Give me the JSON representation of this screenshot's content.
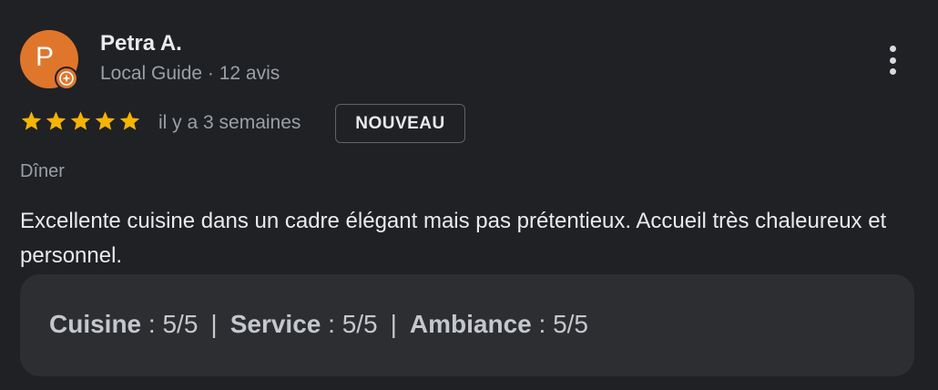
{
  "reviewer": {
    "initial": "P",
    "name": "Petra A.",
    "meta": "Local Guide · 12 avis",
    "avatar_color": "#e0762b",
    "badge_icon": "local-guide-star-icon"
  },
  "rating": {
    "stars": 5,
    "max": 5,
    "star_color": "#f4b400",
    "time": "il y a 3 semaines",
    "badge": "NOUVEAU"
  },
  "context": "Dîner",
  "text": "Excellente cuisine dans un cadre élégant mais pas prétentieux. Accueil très chaleureux et personnel.",
  "subratings": [
    {
      "label": "Cuisine",
      "value": "5/5"
    },
    {
      "label": "Service",
      "value": "5/5"
    },
    {
      "label": "Ambiance",
      "value": "5/5"
    }
  ],
  "subrating_separator": "|",
  "subrating_colon": " : ",
  "menu_icon": "more-vert-icon"
}
